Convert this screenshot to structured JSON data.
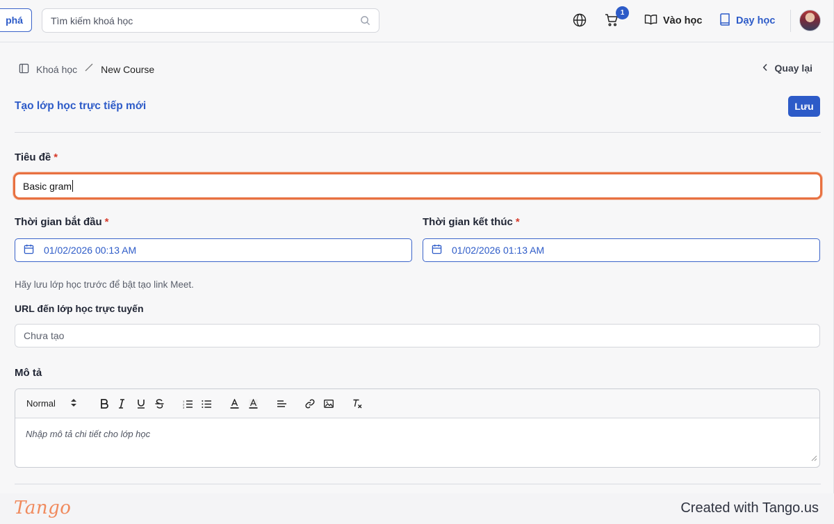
{
  "nav": {
    "explore_label": "phá",
    "search_placeholder": "Tìm kiếm khoá học",
    "cart_count": "1",
    "learn_label": "Vào học",
    "teach_label": "Dạy học"
  },
  "breadcrumb": {
    "courses": "Khoá học",
    "current": "New Course",
    "back": "Quay lại"
  },
  "page": {
    "title": "Tạo lớp học trực tiếp mới",
    "save_label": "Lưu"
  },
  "form": {
    "title_label": "Tiêu đề",
    "required_mark": "*",
    "title_value": "Basic gram",
    "start_label": "Thời gian bắt đầu",
    "start_value": "01/02/2026 00:13 AM",
    "end_label": "Thời gian kết thúc",
    "end_value": "01/02/2026 01:13 AM",
    "meet_hint": "Hãy lưu lớp học trước để bật tạo link Meet.",
    "url_label": "URL đến lớp học trực tuyến",
    "url_value": "Chưa tạo",
    "description_label": "Mô tả",
    "format_select": "Normal",
    "description_placeholder": "Nhập mô tả chi tiết cho lớp học"
  },
  "footer": {
    "logo": "Tango",
    "created_with": "Created with Tango.us"
  },
  "colors": {
    "accent": "#2d5bc8",
    "focus_ring": "#e87141",
    "required": "#d63a2a"
  }
}
